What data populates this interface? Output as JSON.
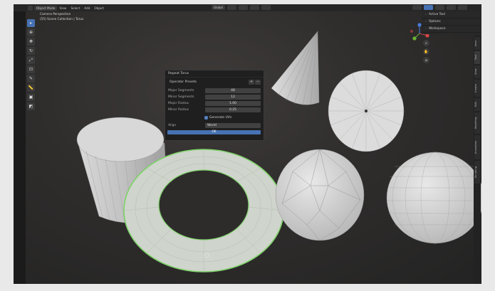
{
  "header": {
    "mode": "Object Mode",
    "menus": [
      "View",
      "Select",
      "Add",
      "Object"
    ],
    "transform_orientation": "Global"
  },
  "viewport": {
    "view_label": "Camera Perspective",
    "collection_label": "(55) Scene Collection | Torus"
  },
  "outliner": {
    "rows": [
      "Active Tool",
      "Options",
      "Workspace"
    ]
  },
  "side_tabs": [
    "Item",
    "Tool",
    "View",
    "Create",
    "Edit",
    "Modeling",
    "Animation",
    "Scripting"
  ],
  "operator_panel": {
    "title": "Repeat Torus",
    "presets_label": "Operator Presets",
    "fields": [
      {
        "label": "Major Segments",
        "value": "48"
      },
      {
        "label": "Minor Segments",
        "value": "12"
      },
      {
        "label": "Major Radius",
        "value": "1.00"
      },
      {
        "label": "Minor Radius",
        "value": "0.25"
      }
    ],
    "generate_uvs": "Generate UVs",
    "align_label": "Align",
    "align_value": "World",
    "ok_label": "OK"
  },
  "colors": {
    "selection_outline": "#7fd36a",
    "accent": "#4772b3"
  }
}
